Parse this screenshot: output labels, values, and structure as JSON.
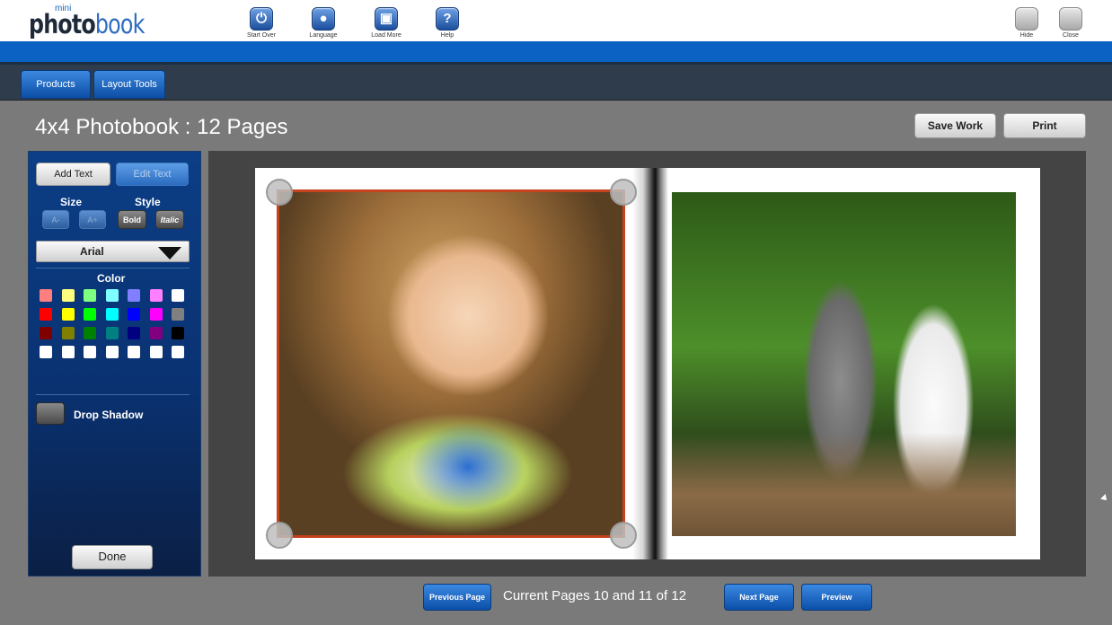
{
  "app": {
    "logo_mini": "mini",
    "logo_photo": "photo",
    "logo_book": "book"
  },
  "toolbar": {
    "start_over": "Start Over",
    "language": "Language",
    "load_more": "Load More",
    "help": "Help",
    "hide": "Hide",
    "close": "Close"
  },
  "menu": {
    "products": "Products",
    "layout_tools": "Layout Tools"
  },
  "page_title": "4x4 Photobook : 12 Pages",
  "actions": {
    "save_work": "Save Work",
    "print": "Print"
  },
  "text_panel": {
    "add_text": "Add Text",
    "edit_text": "Edit Text",
    "size_label": "Size",
    "style_label": "Style",
    "size_up": "A+",
    "size_down": "A-",
    "bold": "Bold",
    "italic": "Italic",
    "font_value": "Arial",
    "color_label": "Color",
    "drop_shadow": "Drop Shadow",
    "done": "Done",
    "colors": [
      [
        "#ff7f7f",
        "#ffff7f",
        "#7fff7f",
        "#7fffff",
        "#7f7fff",
        "#ff7fff",
        "#ffffff"
      ],
      [
        "#ff0000",
        "#ffff00",
        "#00ff00",
        "#00ffff",
        "#0000ff",
        "#ff00ff",
        "#808080"
      ],
      [
        "#800000",
        "#808000",
        "#008000",
        "#008080",
        "#000080",
        "#800080",
        "#000000"
      ],
      [
        "#ffffff",
        "#ffffff",
        "#ffffff",
        "#ffffff",
        "#ffffff",
        "#ffffff",
        "#ffffff"
      ]
    ]
  },
  "book": {
    "frame_color": "#c4431d"
  },
  "nav": {
    "previous": "Previous Page",
    "current": "Current Pages 10 and 11 of 12",
    "next": "Next Page",
    "preview": "Preview"
  }
}
